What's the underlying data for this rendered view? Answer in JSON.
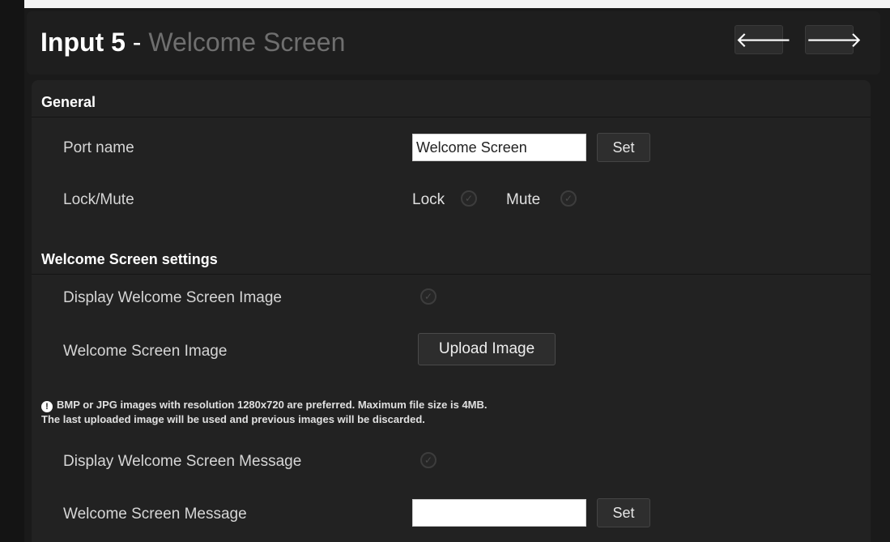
{
  "header": {
    "title_bold": "Input 5",
    "title_separator": " - ",
    "title_light": "Welcome Screen",
    "prev_icon": "arrow-left-icon",
    "next_icon": "arrow-right-icon",
    "prev_glyph": "🡐",
    "next_glyph": "🡒"
  },
  "general": {
    "title": "General",
    "port_name": {
      "label": "Port name",
      "value": "Welcome Screen",
      "set_label": "Set"
    },
    "lock_mute": {
      "label": "Lock/Mute",
      "lock_label": "Lock",
      "mute_label": "Mute"
    }
  },
  "welcome": {
    "title": "Welcome Screen settings",
    "display_image": {
      "label": "Display Welcome Screen Image"
    },
    "image": {
      "label": "Welcome Screen Image",
      "button_label": "Upload Image"
    },
    "info_line1": "BMP or JPG images with resolution 1280x720 are preferred. Maximum file size is 4MB.",
    "info_line2": "The last uploaded image will be used and previous images will be discarded.",
    "display_message": {
      "label": "Display Welcome Screen Message"
    },
    "message": {
      "label": "Welcome Screen Message",
      "value": "",
      "set_label": "Set"
    }
  },
  "icons": {
    "toggle": "check-circle-icon",
    "info": "info-icon"
  }
}
